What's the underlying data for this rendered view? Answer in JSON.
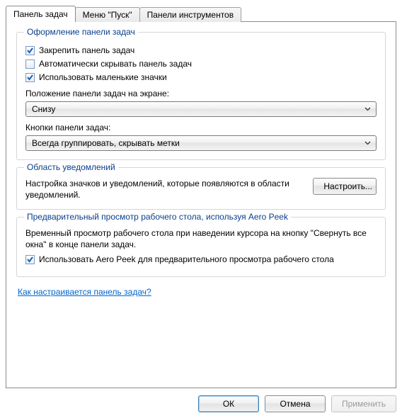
{
  "tabs": [
    {
      "label": "Панель задач",
      "active": true
    },
    {
      "label": "Меню \"Пуск\"",
      "active": false
    },
    {
      "label": "Панели инструментов",
      "active": false
    }
  ],
  "group_appearance": {
    "legend": "Оформление панели задач",
    "lock_taskbar": {
      "label": "Закрепить панель задач",
      "checked": true
    },
    "auto_hide": {
      "label": "Автоматически скрывать панель задач",
      "checked": false
    },
    "small_icons": {
      "label": "Использовать маленькие значки",
      "checked": true
    },
    "position_label": "Положение панели задач на экране:",
    "position_value": "Снизу",
    "buttons_label": "Кнопки панели задач:",
    "buttons_value": "Всегда группировать, скрывать метки"
  },
  "group_notify": {
    "legend": "Область уведомлений",
    "desc": "Настройка значков и уведомлений, которые появляются в области уведомлений.",
    "customize_label": "Настроить..."
  },
  "group_aero": {
    "legend": "Предварительный просмотр рабочего стола, используя Aero Peek",
    "desc": "Временный просмотр рабочего стола при наведении курсора на кнопку \"Свернуть все окна\" в конце панели задач.",
    "use_aero_peek": {
      "label": "Использовать Aero Peek для предварительного просмотра рабочего стола",
      "checked": true
    }
  },
  "help_link": "Как настраивается панель задач?",
  "buttons": {
    "ok": "ОК",
    "cancel": "Отмена",
    "apply": "Применить"
  }
}
